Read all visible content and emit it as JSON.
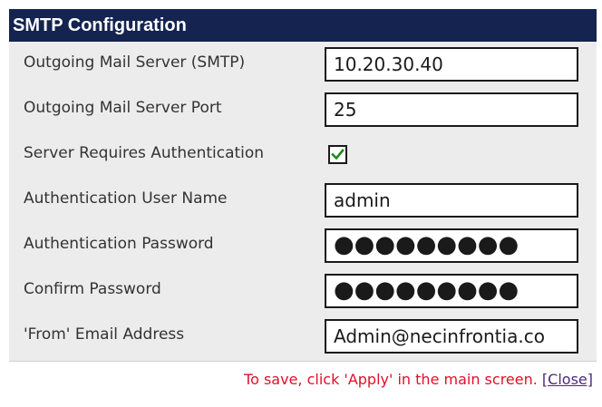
{
  "window": {
    "title": "SMTP Configuration"
  },
  "fields": {
    "outgoing_server": {
      "label": "Outgoing Mail Server (SMTP)",
      "value": "10.20.30.40"
    },
    "outgoing_port": {
      "label": "Outgoing Mail Server Port",
      "value": "25"
    },
    "requires_auth": {
      "label": "Server Requires Authentication",
      "checked": true
    },
    "auth_username": {
      "label": "Authentication User Name",
      "value": "admin"
    },
    "auth_password": {
      "label": "Authentication Password",
      "value": "●●●●●●●●●"
    },
    "confirm_password": {
      "label": "Confirm Password",
      "value": "●●●●●●●●●"
    },
    "from_email": {
      "label": "'From' Email Address",
      "value": "Admin@necinfrontia.co"
    }
  },
  "footer": {
    "save_note": "To save, click 'Apply' in the main screen.",
    "close_link": "[Close]"
  },
  "colors": {
    "title_bg": "#14234f",
    "body_bg": "#ececec",
    "save_note": "#e0102a",
    "checkmark": "#1e8a1e"
  }
}
